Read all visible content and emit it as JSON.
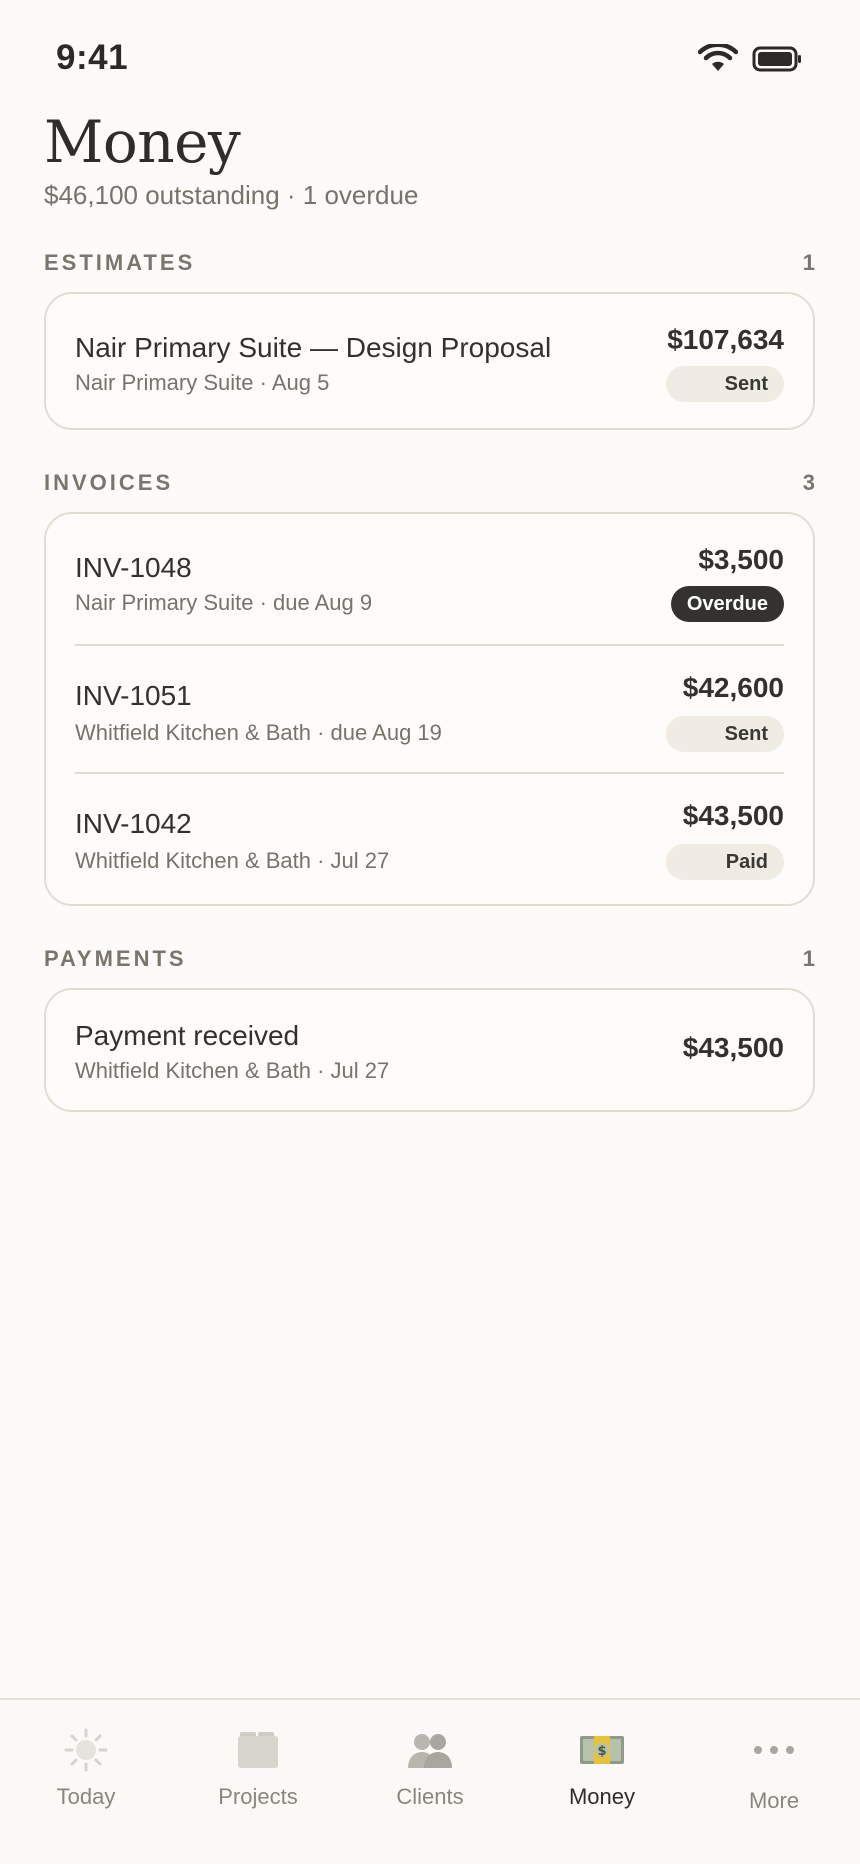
{
  "status_bar": {
    "time": "9:41"
  },
  "header": {
    "title": "Money",
    "subtitle": "$46,100 outstanding · 1 overdue"
  },
  "estimates": {
    "title": "ESTIMATES",
    "count": "1",
    "items": [
      {
        "title": "Nair Primary Suite — Design Proposal",
        "subtitle": "Nair Primary Suite · Aug 5",
        "amount": "$107,634",
        "status": "Sent"
      }
    ]
  },
  "invoices": {
    "title": "INVOICES",
    "count": "3",
    "items": [
      {
        "title": "INV-1048",
        "subtitle": "Nair Primary Suite · due Aug 9",
        "amount": "$3,500",
        "status": "Overdue"
      },
      {
        "title": "INV-1051",
        "subtitle": "Whitfield Kitchen & Bath · due Aug 19",
        "amount": "$42,600",
        "status": "Sent"
      },
      {
        "title": "INV-1042",
        "subtitle": "Whitfield Kitchen & Bath · Jul 27",
        "amount": "$43,500",
        "status": "Paid"
      }
    ]
  },
  "payments": {
    "title": "PAYMENTS",
    "count": "1",
    "items": [
      {
        "title": "Payment received",
        "subtitle": "Whitfield Kitchen & Bath · Jul 27",
        "amount": "$43,500"
      }
    ]
  },
  "tab_bar": {
    "active": "Money",
    "tabs": [
      {
        "label": "Today",
        "icon": "sun-icon"
      },
      {
        "label": "Projects",
        "icon": "folder-icon"
      },
      {
        "label": "Clients",
        "icon": "people-icon"
      },
      {
        "label": "Money",
        "icon": "money-icon"
      },
      {
        "label": "More",
        "icon": "more-icon"
      }
    ]
  },
  "colors": {
    "background": "#fcfbf9",
    "text": "#33312d",
    "muted": "#77736b",
    "border": "#e2ddd3",
    "badge_light": "#f0ece3",
    "badge_dark": "#33322f"
  }
}
